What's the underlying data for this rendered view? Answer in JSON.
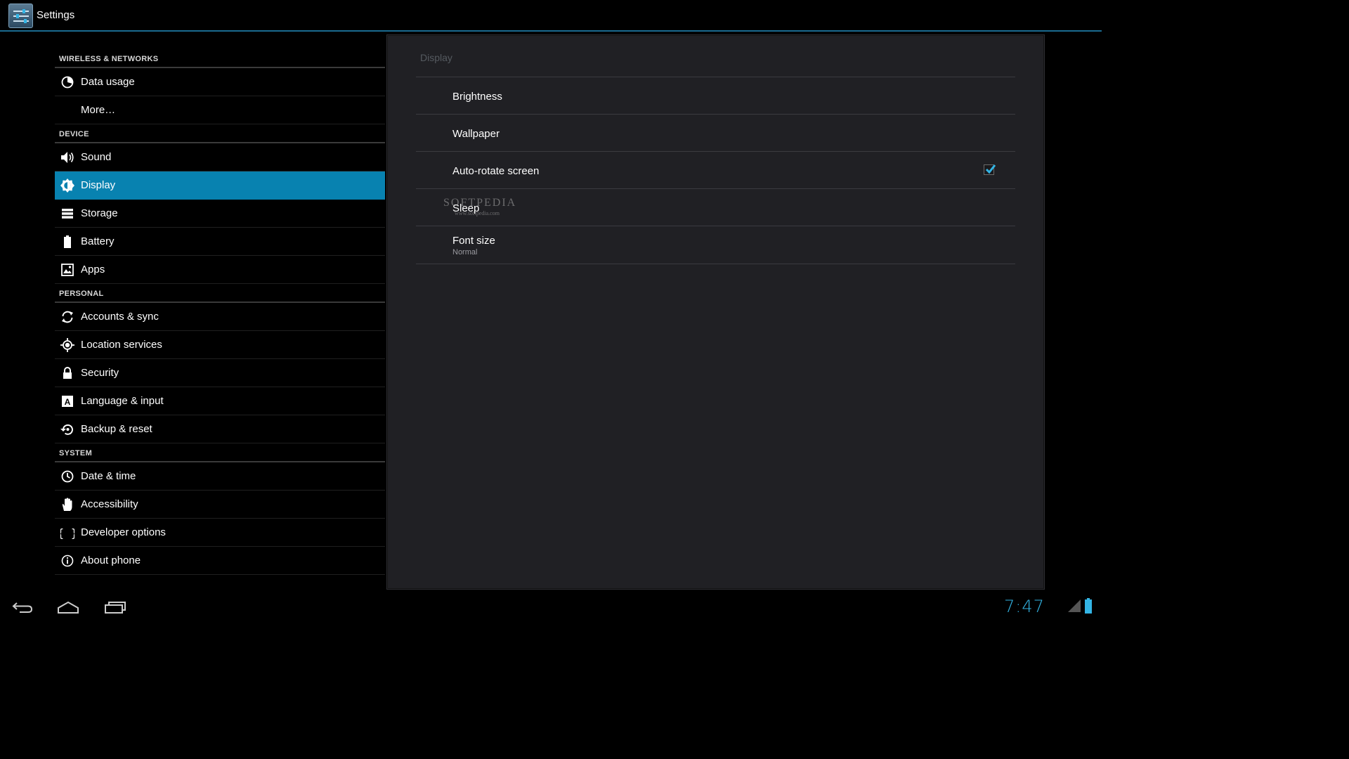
{
  "app": {
    "title": "Settings"
  },
  "sections": {
    "wireless": "WIRELESS & NETWORKS",
    "device": "DEVICE",
    "personal": "PERSONAL",
    "system": "SYSTEM"
  },
  "headers": {
    "data_usage": "Data usage",
    "more": "More…",
    "sound": "Sound",
    "display": "Display",
    "storage": "Storage",
    "battery": "Battery",
    "apps": "Apps",
    "accounts": "Accounts & sync",
    "location": "Location services",
    "security": "Security",
    "language": "Language & input",
    "backup": "Backup & reset",
    "datetime": "Date & time",
    "accessibility": "Accessibility",
    "developer": "Developer options",
    "about": "About phone"
  },
  "selected_header": "Display",
  "panel": {
    "title": "Display",
    "prefs": {
      "brightness": "Brightness",
      "wallpaper": "Wallpaper",
      "autorotate": "Auto-rotate screen",
      "sleep": "Sleep",
      "fontsize": "Font size",
      "fontsize_summary": "Normal"
    },
    "autorotate_checked": true
  },
  "watermark": {
    "brand": "SOFTPEDIA",
    "url": "www.softpedia.com"
  },
  "statusbar": {
    "time": "7:47"
  },
  "colors": {
    "accent": "#33b5e5",
    "selected": "#0882b0",
    "panel_bg": "#202024"
  },
  "icons": {
    "data_usage": "pie-chart-icon",
    "sound": "speaker-icon",
    "display": "brightness-icon",
    "storage": "storage-icon",
    "battery": "battery-icon",
    "apps": "apps-icon",
    "accounts": "sync-icon",
    "location": "location-icon",
    "security": "lock-icon",
    "language": "keyboard-a-icon",
    "backup": "backup-icon",
    "datetime": "clock-icon",
    "accessibility": "hand-icon",
    "developer": "braces-icon",
    "about": "info-icon"
  }
}
